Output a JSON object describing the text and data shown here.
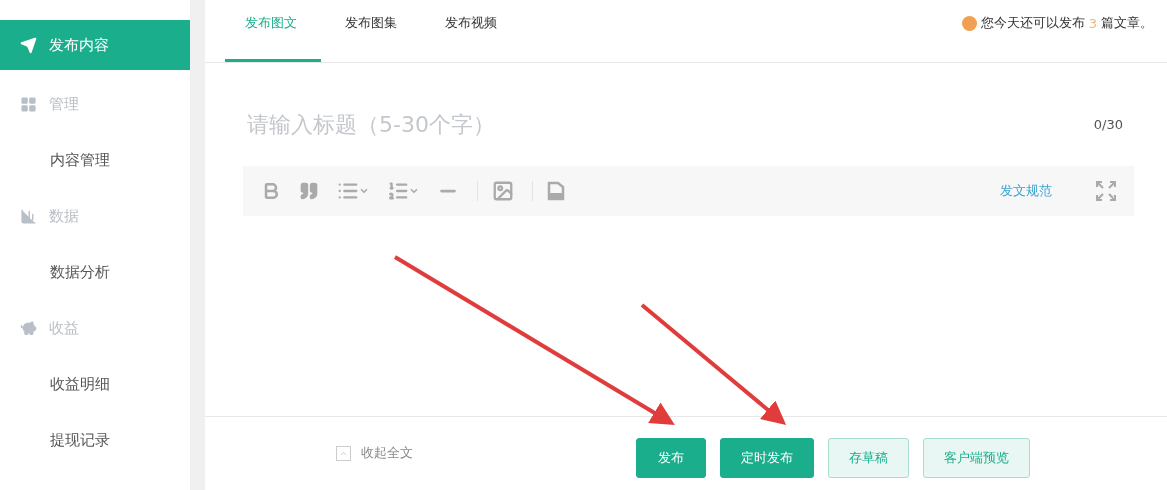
{
  "sidebar": {
    "items": [
      {
        "label": "发布内容",
        "kind": "group",
        "selected": true
      },
      {
        "label": "管理",
        "kind": "group",
        "selected": false
      },
      {
        "label": "内容管理",
        "kind": "link",
        "selected": false
      },
      {
        "label": "数据",
        "kind": "group",
        "selected": false
      },
      {
        "label": "数据分析",
        "kind": "link",
        "selected": false
      },
      {
        "label": "收益",
        "kind": "group",
        "selected": false
      },
      {
        "label": "收益明细",
        "kind": "link",
        "selected": false
      },
      {
        "label": "提现记录",
        "kind": "link",
        "selected": false
      }
    ]
  },
  "tabs": [
    {
      "label": "发布图文",
      "selected": true
    },
    {
      "label": "发布图集",
      "selected": false
    },
    {
      "label": "发布视频",
      "selected": false
    }
  ],
  "notice": {
    "before": "您今天还可以发布",
    "count": "3",
    "after": "篇文章。"
  },
  "title_field": {
    "placeholder": "请输入标题（5-30个字）",
    "counter": "0/30"
  },
  "toolbar": {
    "link": "发文规范"
  },
  "footer": {
    "collapse": "收起全文",
    "buttons": [
      {
        "label": "发布",
        "kind": "primary"
      },
      {
        "label": "定时发布",
        "kind": "primary"
      },
      {
        "label": "存草稿",
        "kind": "secondary"
      },
      {
        "label": "客户端预览",
        "kind": "secondary"
      }
    ]
  }
}
